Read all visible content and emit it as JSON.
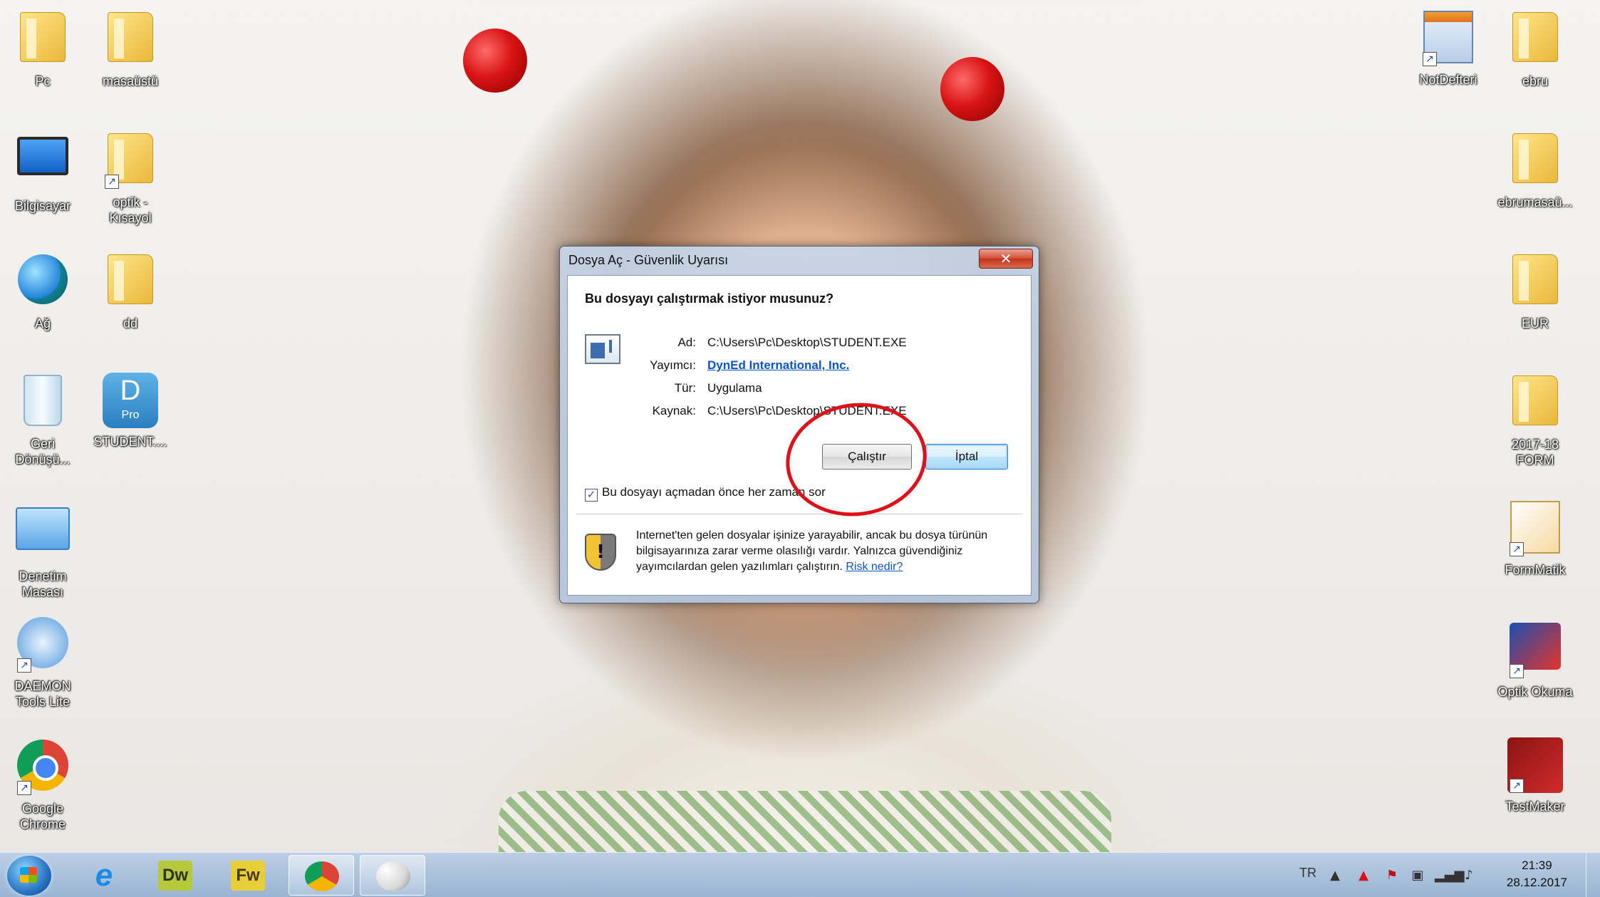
{
  "desktop": {
    "left_icons": [
      {
        "label": "Pc",
        "icon": "user-folder-icon"
      },
      {
        "label": "masaüstü",
        "icon": "folder-icon"
      },
      {
        "label": "Bilgisayar",
        "icon": "computer-icon"
      },
      {
        "label": "optik - Kısayol",
        "icon": "folder-shortcut-icon"
      },
      {
        "label": "Ağ",
        "icon": "network-globe-icon"
      },
      {
        "label": "dd",
        "icon": "folder-icon"
      },
      {
        "label": "Geri Dönüşü...",
        "icon": "recycle-bin-icon"
      },
      {
        "label": "STUDENT....",
        "icon": "dyned-pro-icon",
        "icon_text": "D",
        "icon_sub": "Pro"
      },
      {
        "label": "Denetim Masası",
        "icon": "control-panel-icon"
      },
      {
        "label": "DAEMON Tools Lite",
        "icon": "daemon-tools-icon"
      },
      {
        "label": "Google Chrome",
        "icon": "chrome-icon"
      }
    ],
    "right_icons": [
      {
        "label": "NotDefteri",
        "icon": "notepad-icon"
      },
      {
        "label": "ebru",
        "icon": "folder-icon"
      },
      {
        "label": "ebrumasaü...",
        "icon": "folder-icon"
      },
      {
        "label": "EUR",
        "icon": "folder-icon"
      },
      {
        "label": "2017-18 FORM",
        "icon": "folder-icon"
      },
      {
        "label": "FormMatik",
        "icon": "formmatik-icon"
      },
      {
        "label": "Optik Okuma",
        "icon": "optik-okuma-icon"
      },
      {
        "label": "TestMaker",
        "icon": "testmaker-icon"
      }
    ]
  },
  "dialog": {
    "title": "Dosya Aç - Güvenlik Uyarısı",
    "close_symbol": "✕",
    "question": "Bu dosyayı çalıştırmak istiyor musunuz?",
    "properties": [
      {
        "key": "Ad:",
        "value": "C:\\Users\\Pc\\Desktop\\STUDENT.EXE",
        "link": false
      },
      {
        "key": "Yayımcı:",
        "value": "DynEd International, Inc.",
        "link": true
      },
      {
        "key": "Tür:",
        "value": "Uygulama",
        "link": false
      },
      {
        "key": "Kaynak:",
        "value": "C:\\Users\\Pc\\Desktop\\STUDENT.EXE",
        "link": false
      }
    ],
    "run_button": "Çalıştır",
    "cancel_button": "İptal",
    "checkbox_label": "Bu dosyayı açmadan önce her zaman sor",
    "checkbox_checked": true,
    "warning_text": "Internet'ten gelen dosyalar işinize yarayabilir, ancak bu dosya türünün bilgisayarınıza zarar verme olasılığı vardır. Yalnızca güvendiğiniz yayımcılardan gelen yazılımları çalıştırın.",
    "risk_link": "Risk nedir?",
    "annotation_color": "#e0101a"
  },
  "taskbar": {
    "apps": [
      {
        "name": "Internet Explorer",
        "glyph": "e",
        "icon": "internet-explorer-icon"
      },
      {
        "name": "Dreamweaver",
        "glyph": "Dw",
        "icon": "dreamweaver-icon"
      },
      {
        "name": "Fireworks",
        "glyph": "Fw",
        "icon": "fireworks-icon"
      },
      {
        "name": "Google Chrome",
        "glyph": "",
        "icon": "chrome-icon"
      },
      {
        "name": "Paint",
        "glyph": "",
        "icon": "paint-icon"
      }
    ],
    "language": "TR",
    "time": "21:39",
    "date": "28.12.2017"
  }
}
